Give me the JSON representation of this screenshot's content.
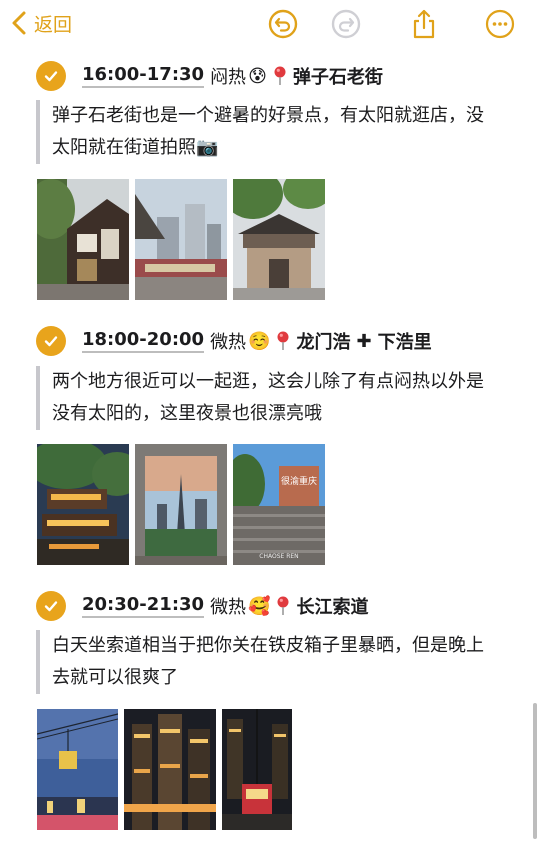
{
  "nav": {
    "back_label": "返回",
    "icons": [
      "chevron-left-icon",
      "undo-icon",
      "redo-icon",
      "share-icon",
      "more-icon"
    ],
    "accent": "#e0a21a"
  },
  "sections": [
    {
      "time": "16:00-17:30",
      "weather": "闷热",
      "emoji": "😰",
      "place": "弹子石老街",
      "text": "弹子石老街也是一个避暑的好景点，有太阳就逛店，没太阳就在街道拍照📷"
    },
    {
      "time": "18:00-20:00",
      "weather": "微热",
      "emoji": "☺️",
      "place": "龙门浩",
      "place2": "下浩里",
      "text": "两个地方很近可以一起逛，这会儿除了有点闷热以外是没有太阳的，这里夜景也很漂亮哦"
    },
    {
      "time": "20:30-21:30",
      "weather": "微热",
      "emoji": "🥰",
      "place": "长江索道",
      "text": "白天坐索道相当于把你关在铁皮箱子里暴晒，但是晚上去就可以很爽了"
    }
  ],
  "photo_signs": {
    "hao_sign": "很渝重庆",
    "hao_sub": "CHAOSE REN"
  }
}
